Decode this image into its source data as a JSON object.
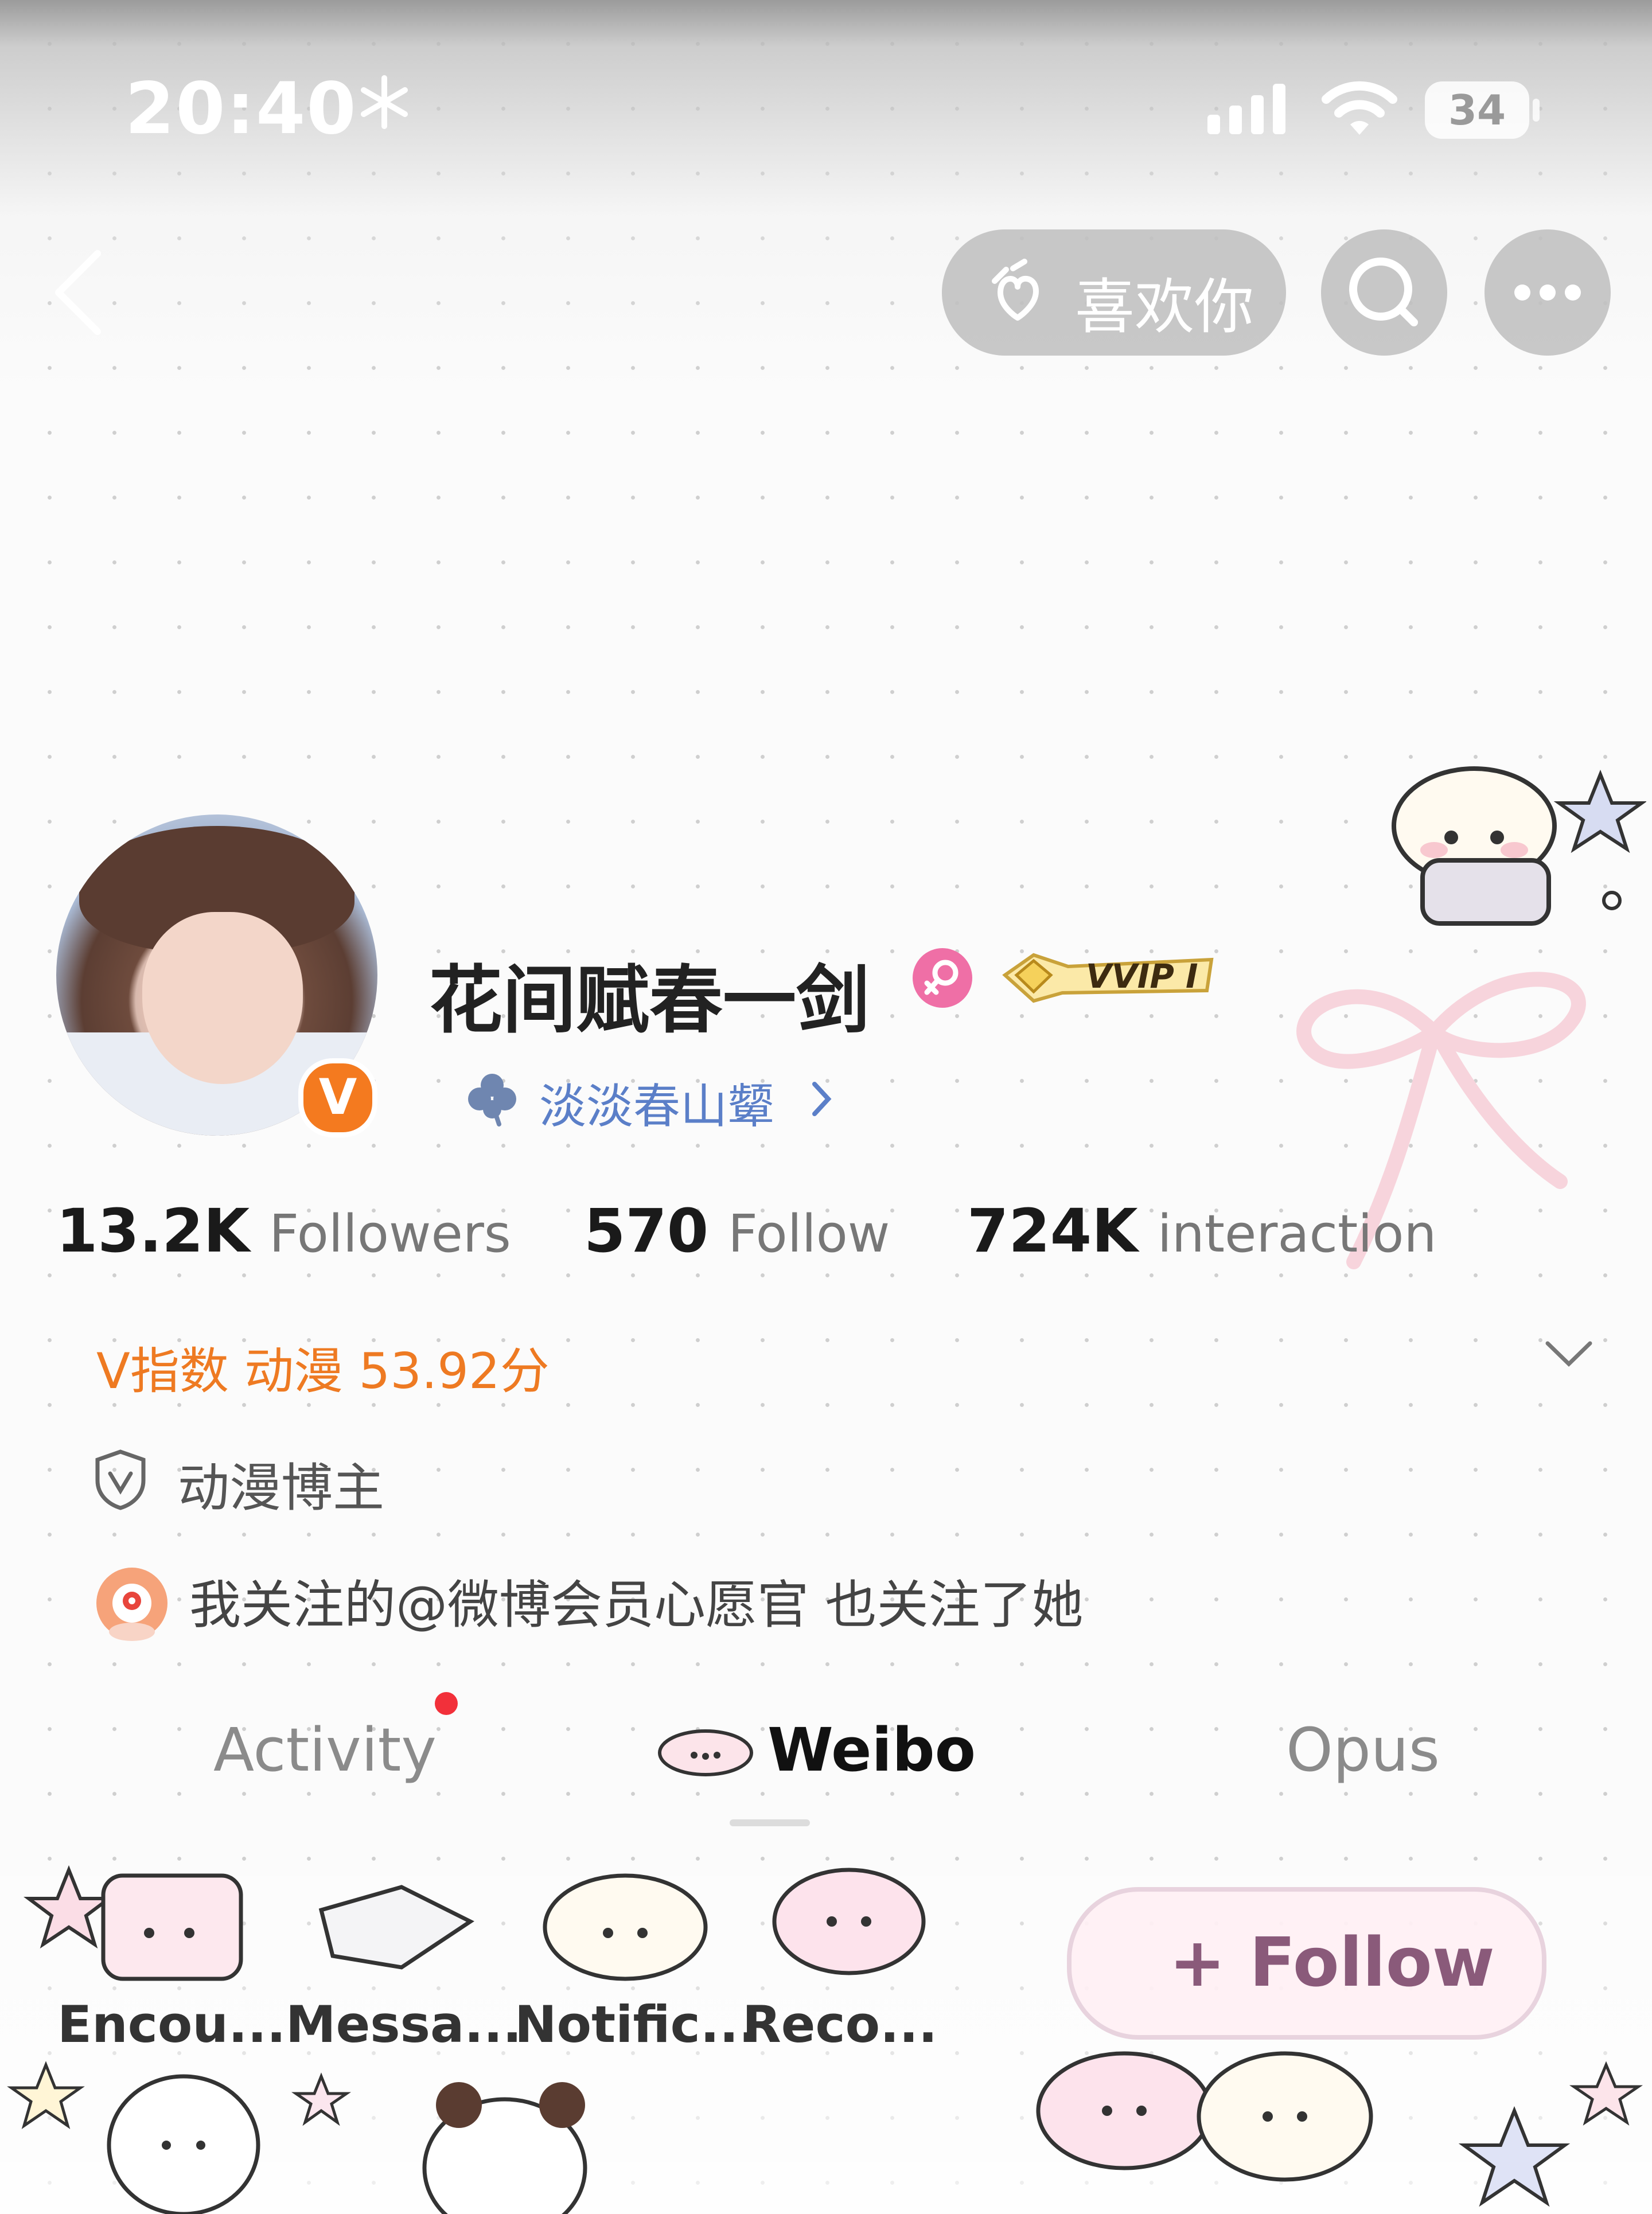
{
  "status_bar": {
    "time": "20:40",
    "battery": "34"
  },
  "header": {
    "like_button_label": "喜欢你"
  },
  "profile": {
    "name": "花间赋春一剑",
    "vip_badge": "VVIP I",
    "verified_badge": "V",
    "subtitle": "淡淡春山颦",
    "stats": [
      {
        "value": "13.2K",
        "label": "Followers"
      },
      {
        "value": "570",
        "label": "Follow"
      },
      {
        "value": "724K",
        "label": "interaction"
      }
    ],
    "v_index": "V指数 动漫 53.92分",
    "category": "动漫博主",
    "mutual_note": "我关注的@微博会员心愿官 也关注了她"
  },
  "tabs": [
    {
      "label": "Activity"
    },
    {
      "label": "Weibo"
    },
    {
      "label": "Opus"
    }
  ],
  "bottom_bar": {
    "items": [
      {
        "label": "Encou..."
      },
      {
        "label": "Messa..."
      },
      {
        "label": "Notific..."
      },
      {
        "label": "Reco..."
      }
    ],
    "follow_label": "+ Follow"
  },
  "colors": {
    "accent_orange": "#ee7a22",
    "verified_orange": "#f47a1f",
    "subtitle_blue": "#5b7fc8",
    "gender_pink": "#ef6fa6",
    "notification_red": "#f2303a"
  },
  "icons": [
    "snowflake-icon",
    "signal-icon",
    "wifi-icon",
    "back-icon",
    "hand-heart-icon",
    "search-icon",
    "more-icon",
    "gender-female-icon",
    "clover-icon",
    "chevron-right-icon",
    "chevron-down-icon",
    "shield-v-icon",
    "mascot-avatar-icon"
  ]
}
